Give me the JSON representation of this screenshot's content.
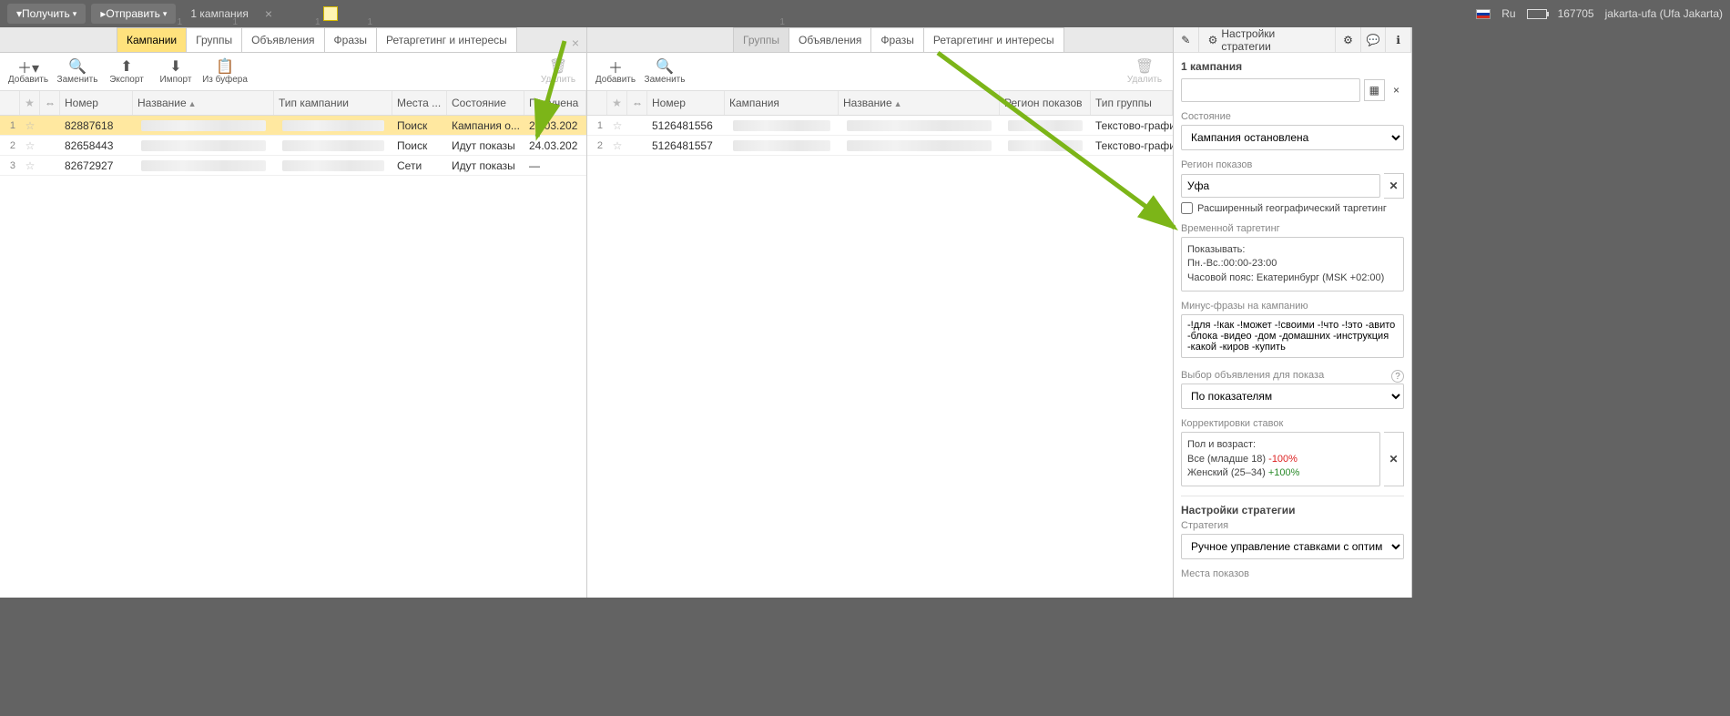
{
  "topbar": {
    "receive": "Получить",
    "send": "Отправить",
    "campaign_count": "1 кампания",
    "lang": "Ru",
    "points": "167705",
    "user": "jakarta-ufa (Ufa Jakarta)"
  },
  "tabs_left": {
    "campaigns": "Кампании",
    "groups": "Группы",
    "ads": "Объявления",
    "phrases": "Фразы",
    "retargeting": "Ретаргетинг и интересы",
    "b1": "1",
    "b2": "1",
    "b3": "1",
    "b4": "1"
  },
  "tabs_mid": {
    "groups": "Группы",
    "ads": "Объявления",
    "phrases": "Фразы",
    "retargeting": "Ретаргетинг и интересы",
    "b1": "1"
  },
  "tools": {
    "add": "Добавить",
    "replace": "Заменить",
    "export": "Экспорт",
    "import": "Импорт",
    "paste": "Из буфера",
    "delete": "Удалить"
  },
  "hdr_left": {
    "num": "Номер",
    "name": "Название",
    "type": "Тип кампании",
    "place": "Места ...",
    "state": "Состояние",
    "date": "Получена"
  },
  "rows_left": [
    {
      "idx": "1",
      "num": "82887618",
      "place": "Поиск",
      "state": "Кампания о...",
      "date": "24.03.202"
    },
    {
      "idx": "2",
      "num": "82658443",
      "place": "Поиск",
      "state": "Идут показы",
      "date": "24.03.202"
    },
    {
      "idx": "3",
      "num": "82672927",
      "place": "Сети",
      "state": "Идут показы",
      "date": "—"
    }
  ],
  "hdr_mid": {
    "num": "Номер",
    "camp": "Кампания",
    "name": "Название",
    "region": "Регион показов",
    "type": "Тип группы"
  },
  "rows_mid": [
    {
      "idx": "1",
      "num": "5126481556",
      "type": "Текстово-графич..."
    },
    {
      "idx": "2",
      "num": "5126481557",
      "type": "Текстово-графич..."
    }
  ],
  "right": {
    "strategy_btn": "Настройки стратегии",
    "title": "1 кампания",
    "state_lbl": "Состояние",
    "state_val": "Кампания остановлена",
    "region_lbl": "Регион показов",
    "region_val": "Уфа",
    "geo_ext": "Расширенный географический таргетинг",
    "time_lbl": "Временной таргетинг",
    "time_box_l1": "Показывать:",
    "time_box_l2": "Пн.-Вс.:00:00-23:00",
    "time_box_l3": "Часовой пояс: Екатеринбург (MSK +02:00)",
    "minus_lbl": "Минус-фразы на кампанию",
    "minus_val": "-!для -!как -!может -!своими -!что -!это -авито -блока -видео -дом -домашних -инструкция -какой -киров -купить",
    "adsel_lbl": "Выбор объявления для показа",
    "adsel_val": "По показателям",
    "corr_lbl": "Корректировки ставок",
    "corr_l1": "Пол и возраст:",
    "corr_l2a": "Все (младше 18) ",
    "corr_l2b": "-100%",
    "corr_l3a": "Женский (25–34) ",
    "corr_l3b": "+100%",
    "sec_strategy": "Настройки стратегии",
    "strat_lbl": "Стратегия",
    "strat_val": "Ручное управление ставками с оптимиза...",
    "places_lbl": "Места показов"
  }
}
